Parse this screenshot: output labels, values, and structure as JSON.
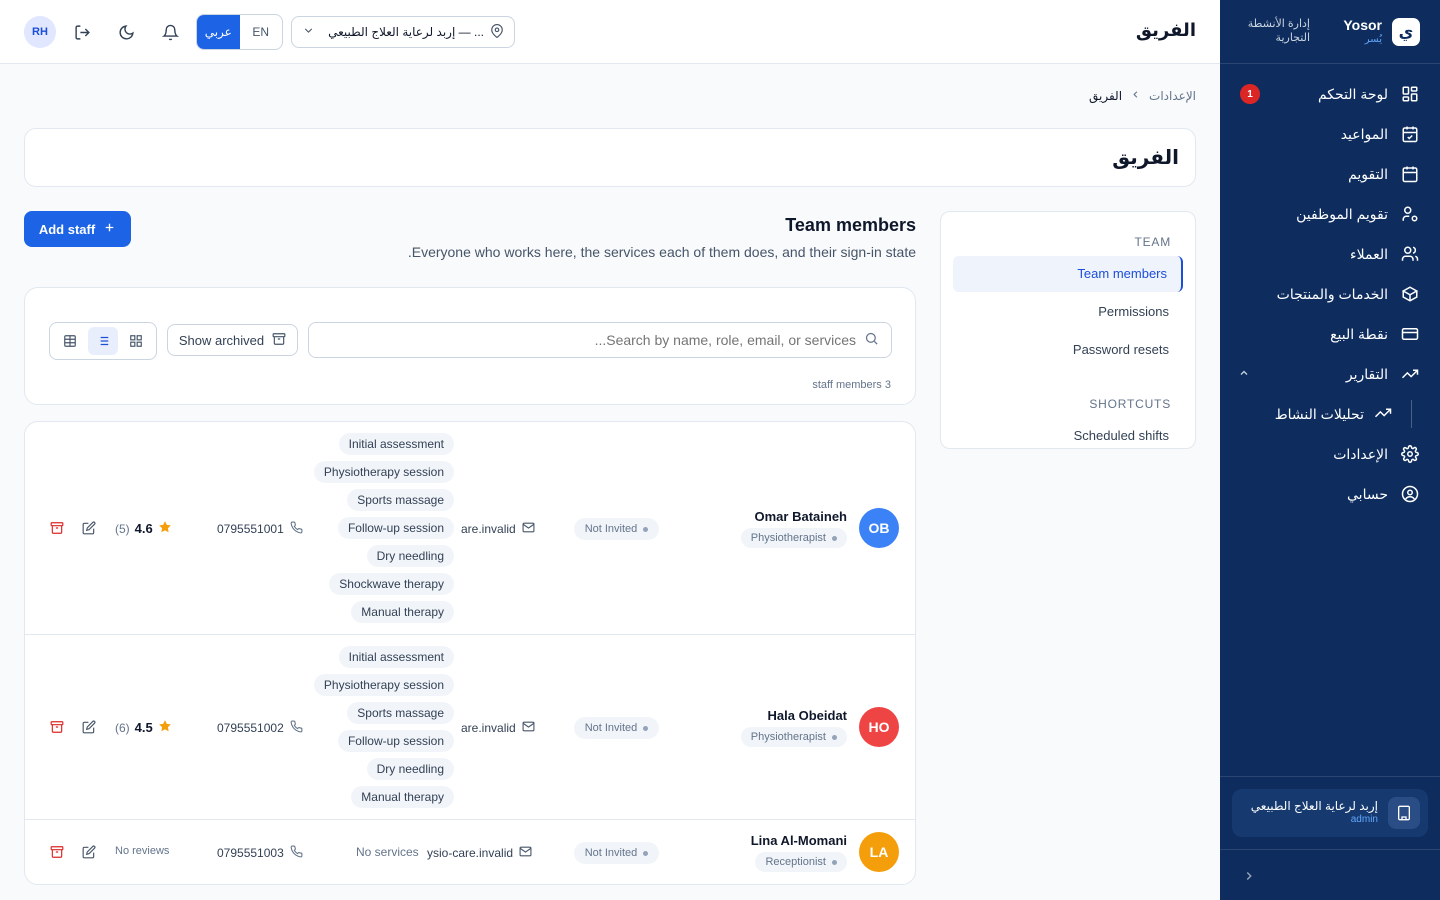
{
  "brand": {
    "name": "Yosor",
    "sub": "يُسر",
    "tagline": "إدارة الأنشطة التجارية",
    "logo_letter": "ي"
  },
  "sidebar": {
    "items": [
      {
        "label": "لوحة التحكم",
        "icon": "dashboard-icon",
        "badge": "1"
      },
      {
        "label": "المواعيد",
        "icon": "calendar-check-icon"
      },
      {
        "label": "التقويم",
        "icon": "calendar-icon"
      },
      {
        "label": "تقويم الموظفين",
        "icon": "user-cog-icon"
      },
      {
        "label": "العملاء",
        "icon": "users-icon"
      },
      {
        "label": "الخدمات والمنتجات",
        "icon": "package-icon"
      },
      {
        "label": "نقطة البيع",
        "icon": "credit-card-icon"
      },
      {
        "label": "التقارير",
        "icon": "trending-up-icon"
      }
    ],
    "sub_item": {
      "label": "تحليلات النشاط",
      "icon": "trending-up-icon"
    },
    "bottom_items": [
      {
        "label": "الإعدادات",
        "icon": "settings-icon"
      },
      {
        "label": "حسابي",
        "icon": "user-circle-icon"
      }
    ],
    "org": {
      "name": "إربد لرعاية العلاج الطبيعي",
      "role": "admin"
    }
  },
  "topbar": {
    "title": "الفريق",
    "avatar": "RH",
    "lang_en": "EN",
    "lang_ar": "عربي",
    "location": "إربد لرعاية العلاج الطبيعي — ..."
  },
  "breadcrumb": {
    "parent": "الإعدادات",
    "current": "الفريق"
  },
  "page_title": "الفريق",
  "section_nav": {
    "team_heading": "TEAM",
    "items": [
      "Team members",
      "Permissions",
      "Password resets"
    ],
    "shortcuts_heading": "SHORTCUTS",
    "shortcuts": [
      "Scheduled shifts"
    ]
  },
  "team": {
    "title": "Team members",
    "subtitle": "Everyone who works here, the services each of them does, and their sign-in state.",
    "add_label": "Add staff",
    "show_archived": "Show archived",
    "search_placeholder": "Search by name, role, email, or services...",
    "count": "3 staff members"
  },
  "staff": [
    {
      "initials": "OB",
      "color": "#3b82f6",
      "name": "Omar Bataineh",
      "role": "Physiotherapist",
      "status": "Not Invited",
      "email": "are.invalid",
      "services": [
        "Initial assessment",
        "Physiotherapy session",
        "Sports massage",
        "Follow-up session",
        "Dry needling",
        "Shockwave therapy",
        "Manual therapy"
      ],
      "phone": "0795551001",
      "rating": "4.6",
      "reviews": "(5)"
    },
    {
      "initials": "HO",
      "color": "#ef4444",
      "name": "Hala Obeidat",
      "role": "Physiotherapist",
      "status": "Not Invited",
      "email": "are.invalid",
      "services": [
        "Initial assessment",
        "Physiotherapy session",
        "Sports massage",
        "Follow-up session",
        "Dry needling",
        "Manual therapy"
      ],
      "phone": "0795551002",
      "rating": "4.5",
      "reviews": "(6)"
    },
    {
      "initials": "LA",
      "color": "#f59e0b",
      "name": "Lina Al-Momani",
      "role": "Receptionist",
      "status": "Not Invited",
      "email": "ysio-care.invalid",
      "no_services": "No services",
      "phone": "0795551003",
      "no_reviews": "No reviews"
    }
  ]
}
